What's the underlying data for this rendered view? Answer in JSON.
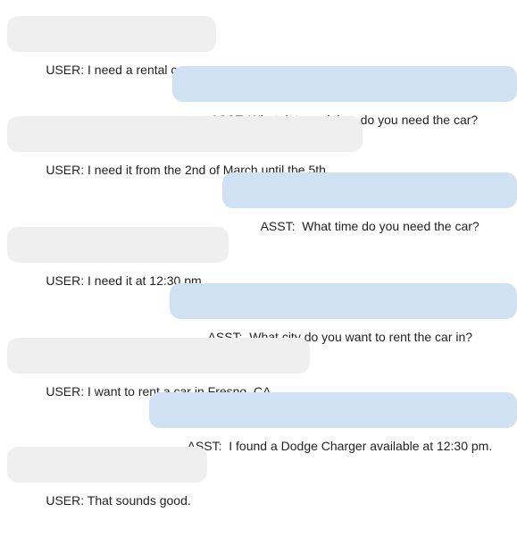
{
  "conversation": {
    "messages": [
      {
        "role": "user",
        "text": "USER: I need a rental car."
      },
      {
        "role": "asst",
        "text": "ASST: What date and time do you need the car?"
      },
      {
        "role": "user",
        "text": "USER: I need it from the 2nd of March until the 5th."
      },
      {
        "role": "asst",
        "text": "ASST:  What time do you need the car?"
      },
      {
        "role": "user",
        "text": "USER: I need it at 12:30 pm."
      },
      {
        "role": "asst",
        "text": "ASST:  What city do you want to rent the car in?"
      },
      {
        "role": "user",
        "text": "USER: I want to rent a car in Fresno, CA."
      },
      {
        "role": "asst",
        "text": "ASST:  I found a Dodge Charger available at 12:30 pm."
      },
      {
        "role": "user",
        "text": "USER: That sounds good."
      }
    ]
  },
  "colors": {
    "user_bubble": "#efefef",
    "asst_bubble": "#cfe1f3",
    "text": "#222222"
  }
}
